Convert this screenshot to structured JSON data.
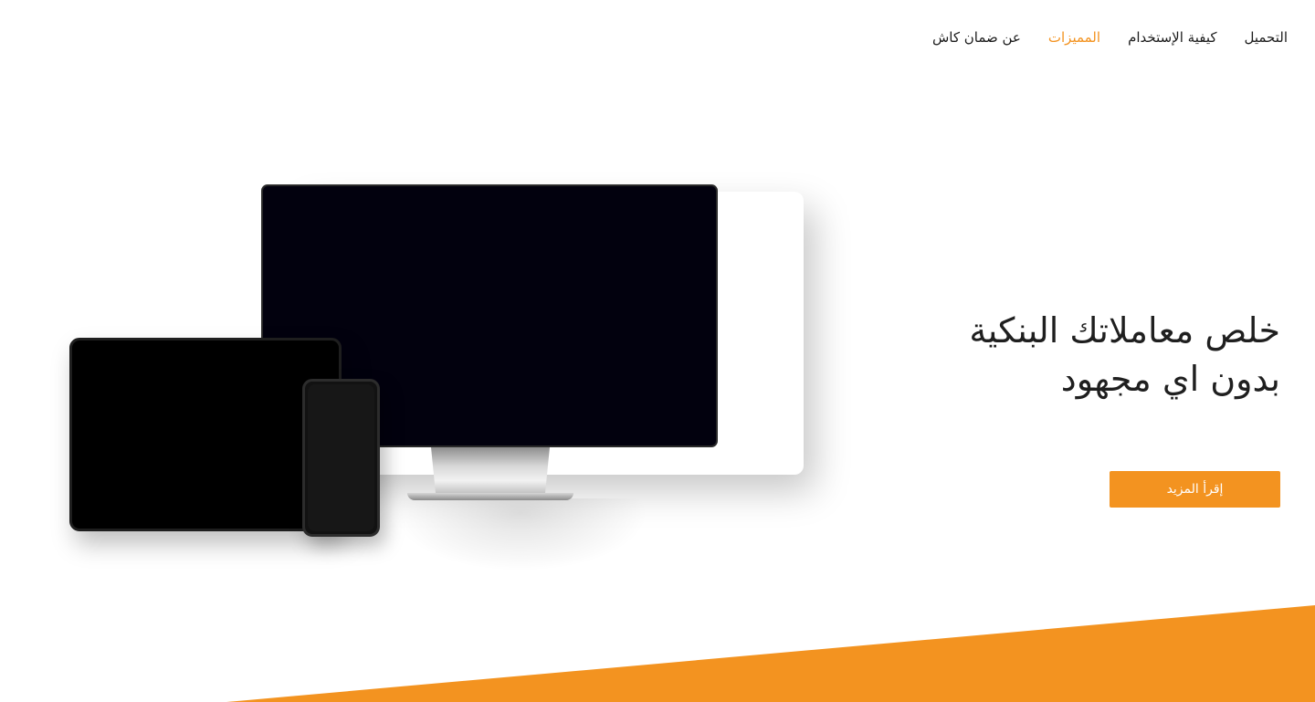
{
  "nav": {
    "items": [
      {
        "label": "عن ضمان كاش",
        "active": false
      },
      {
        "label": "المميزات",
        "active": true
      },
      {
        "label": "كيفية الإستخدام",
        "active": false
      },
      {
        "label": "التحميل",
        "active": false
      }
    ]
  },
  "hero": {
    "title_line1": "خلص معاملاتك البنكية",
    "title_line2": "بدون اي مجهود",
    "cta_label": "إقرأ المزيد"
  },
  "colors": {
    "accent": "#f39320",
    "text": "#1f1f1f",
    "background": "#ffffff"
  }
}
